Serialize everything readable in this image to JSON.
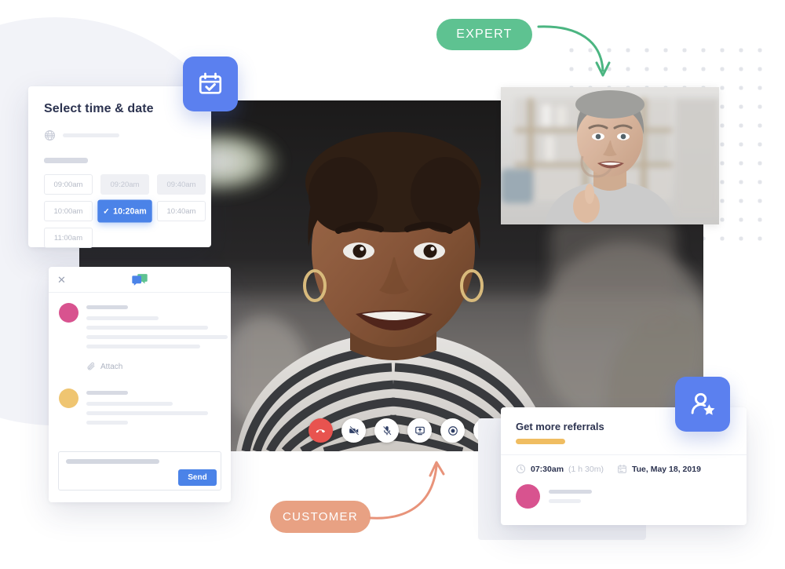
{
  "labels": {
    "expert_pill": "EXPERT",
    "customer_pill": "CUSTOMER"
  },
  "schedule_card": {
    "title": "Select time & date",
    "timezone_icon": "globe-icon",
    "slots": [
      {
        "time": "09:00am",
        "state": "available"
      },
      {
        "time": "09:20am",
        "state": "unavailable"
      },
      {
        "time": "09:40am",
        "state": "unavailable"
      },
      {
        "time": "10:00am",
        "state": "available"
      },
      {
        "time": "10:20am",
        "state": "selected"
      },
      {
        "time": "10:40am",
        "state": "available"
      },
      {
        "time": "11:00am",
        "state": "available"
      }
    ],
    "check_glyph": "✓"
  },
  "chat_panel": {
    "close_glyph": "✕",
    "logo_icon": "chat-bubbles-logo",
    "attach_label": "Attach",
    "send_label": "Send"
  },
  "call_controls": [
    {
      "name": "hangup-button",
      "glyph": "hangup-icon",
      "variant": "danger"
    },
    {
      "name": "camera-off-button",
      "glyph": "camera-off-icon",
      "variant": "light"
    },
    {
      "name": "mic-off-button",
      "glyph": "mic-off-icon",
      "variant": "light"
    },
    {
      "name": "screen-share-button",
      "glyph": "screen-share-icon",
      "variant": "light"
    },
    {
      "name": "record-button",
      "glyph": "record-icon",
      "variant": "light"
    },
    {
      "name": "settings-button",
      "glyph": "gear-icon",
      "variant": "light"
    }
  ],
  "referrals_card": {
    "title": "Get more referrals",
    "time": "07:30am",
    "duration": "(1 h 30m)",
    "date": "Tue, May 18, 2019",
    "clock_icon": "clock-icon",
    "calendar_icon": "calendar-icon"
  },
  "badges": {
    "calendar": "calendar-check-icon",
    "referral": "person-star-icon"
  },
  "colors": {
    "expert_green": "#5ec291",
    "customer_salmon": "#e8a183",
    "brand_blue": "#4b83e8",
    "badge_blue": "#5b80ef",
    "danger_red": "#e8534f",
    "avatar_pink": "#d8538f",
    "avatar_yellow": "#efc571",
    "accent_orange": "#f0bd61",
    "heading_navy": "#2c3350"
  }
}
